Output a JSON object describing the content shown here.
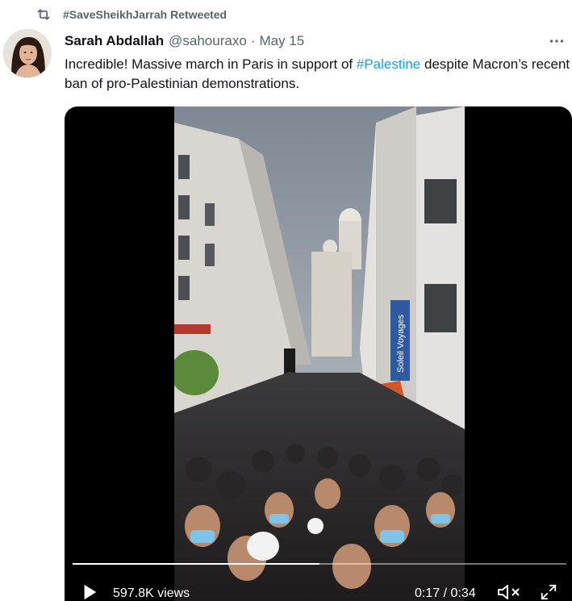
{
  "social_context": {
    "retweeted_by": "#SaveSheikhJarrah Retweeted"
  },
  "tweet": {
    "author": {
      "display_name": "Sarah Abdallah",
      "handle": "@sahouraxo",
      "separator": "·",
      "date": "May 15"
    },
    "text_parts": {
      "before": "Incredible! Massive march in Paris in support of ",
      "hashtag": "#Palestine",
      "after": " despite Macron’s recent ban of pro-Palestinian demonstrations."
    }
  },
  "video": {
    "banner_text": "Soleil Voyages",
    "views": "597.8K views",
    "current_time": "0:17",
    "time_separator": " / ",
    "duration": "0:34",
    "progress_fraction": 0.5
  },
  "icons": {
    "retweet": "retweet-icon",
    "more": "more-icon",
    "play": "play-icon",
    "mute": "mute-icon",
    "fullscreen": "fullscreen-icon"
  },
  "colors": {
    "hashtag": "#1d9bf0",
    "muted_text": "#536471",
    "primary_text": "#0f1419"
  }
}
